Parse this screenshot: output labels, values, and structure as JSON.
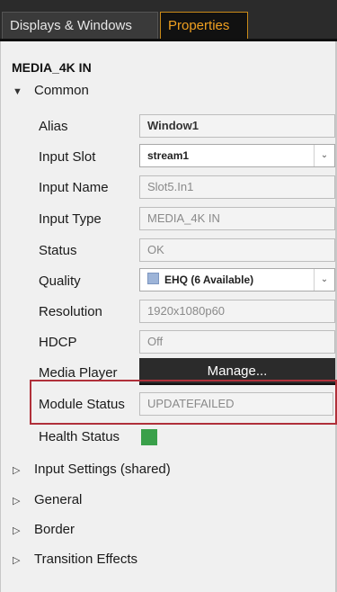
{
  "tabs": {
    "displays_windows": "Displays & Windows",
    "properties": "Properties"
  },
  "object_title": "MEDIA_4K IN",
  "sections": {
    "common": "Common",
    "input_settings": "Input Settings (shared)",
    "general": "General",
    "border": "Border",
    "transition_effects": "Transition Effects"
  },
  "properties": {
    "alias": {
      "label": "Alias",
      "value": "Window1"
    },
    "input_slot": {
      "label": "Input Slot",
      "value": "stream1"
    },
    "input_name": {
      "label": "Input Name",
      "value": "Slot5.In1"
    },
    "input_type": {
      "label": "Input Type",
      "value": "MEDIA_4K IN"
    },
    "status": {
      "label": "Status",
      "value": "OK"
    },
    "quality": {
      "label": "Quality",
      "value": "EHQ (6 Available)"
    },
    "resolution": {
      "label": "Resolution",
      "value": "1920x1080p60"
    },
    "hdcp": {
      "label": "HDCP",
      "value": "Off"
    },
    "media_player": {
      "label": "Media Player",
      "button": "Manage..."
    },
    "module_status": {
      "label": "Module Status",
      "value": "UPDATEFAILED"
    },
    "health_status": {
      "label": "Health Status",
      "color": "#3aa04a"
    }
  },
  "colors": {
    "active_tab_accent": "#f0a020",
    "highlight_border": "#b0303a",
    "health_ok": "#3aa04a"
  },
  "icons": {
    "expanded": "triangle-down",
    "collapsed": "triangle-right",
    "dropdown": "chevron-down"
  }
}
